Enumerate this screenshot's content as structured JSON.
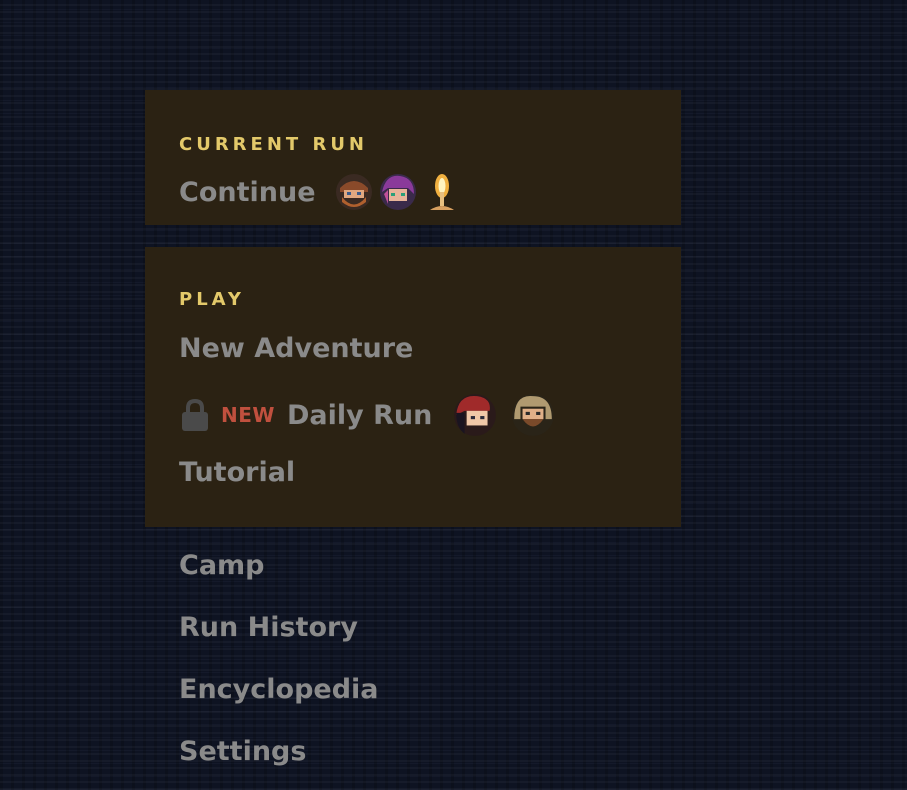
{
  "current_run": {
    "title": "CURRENT RUN",
    "continue_label": "Continue",
    "party_icons": [
      "bearded-warrior-portrait-icon",
      "purple-haired-mage-portrait-icon",
      "candle-flame-icon"
    ]
  },
  "play": {
    "title": "PLAY",
    "new_adventure_label": "New Adventure",
    "daily_run": {
      "locked": true,
      "badge": "NEW",
      "label": "Daily Run",
      "party_icons": [
        "red-hooded-girl-portrait-icon",
        "hooded-bearded-rogue-portrait-icon"
      ]
    },
    "tutorial_label": "Tutorial"
  },
  "menu": {
    "camp_label": "Camp",
    "run_history_label": "Run History",
    "encyclopedia_label": "Encyclopedia",
    "settings_label": "Settings"
  },
  "colors": {
    "panel_bg": "#2b2213",
    "section_title": "#e3c96a",
    "menu_text": "#8a8a8a",
    "new_badge": "#c0503e",
    "background": "#0e1322"
  }
}
